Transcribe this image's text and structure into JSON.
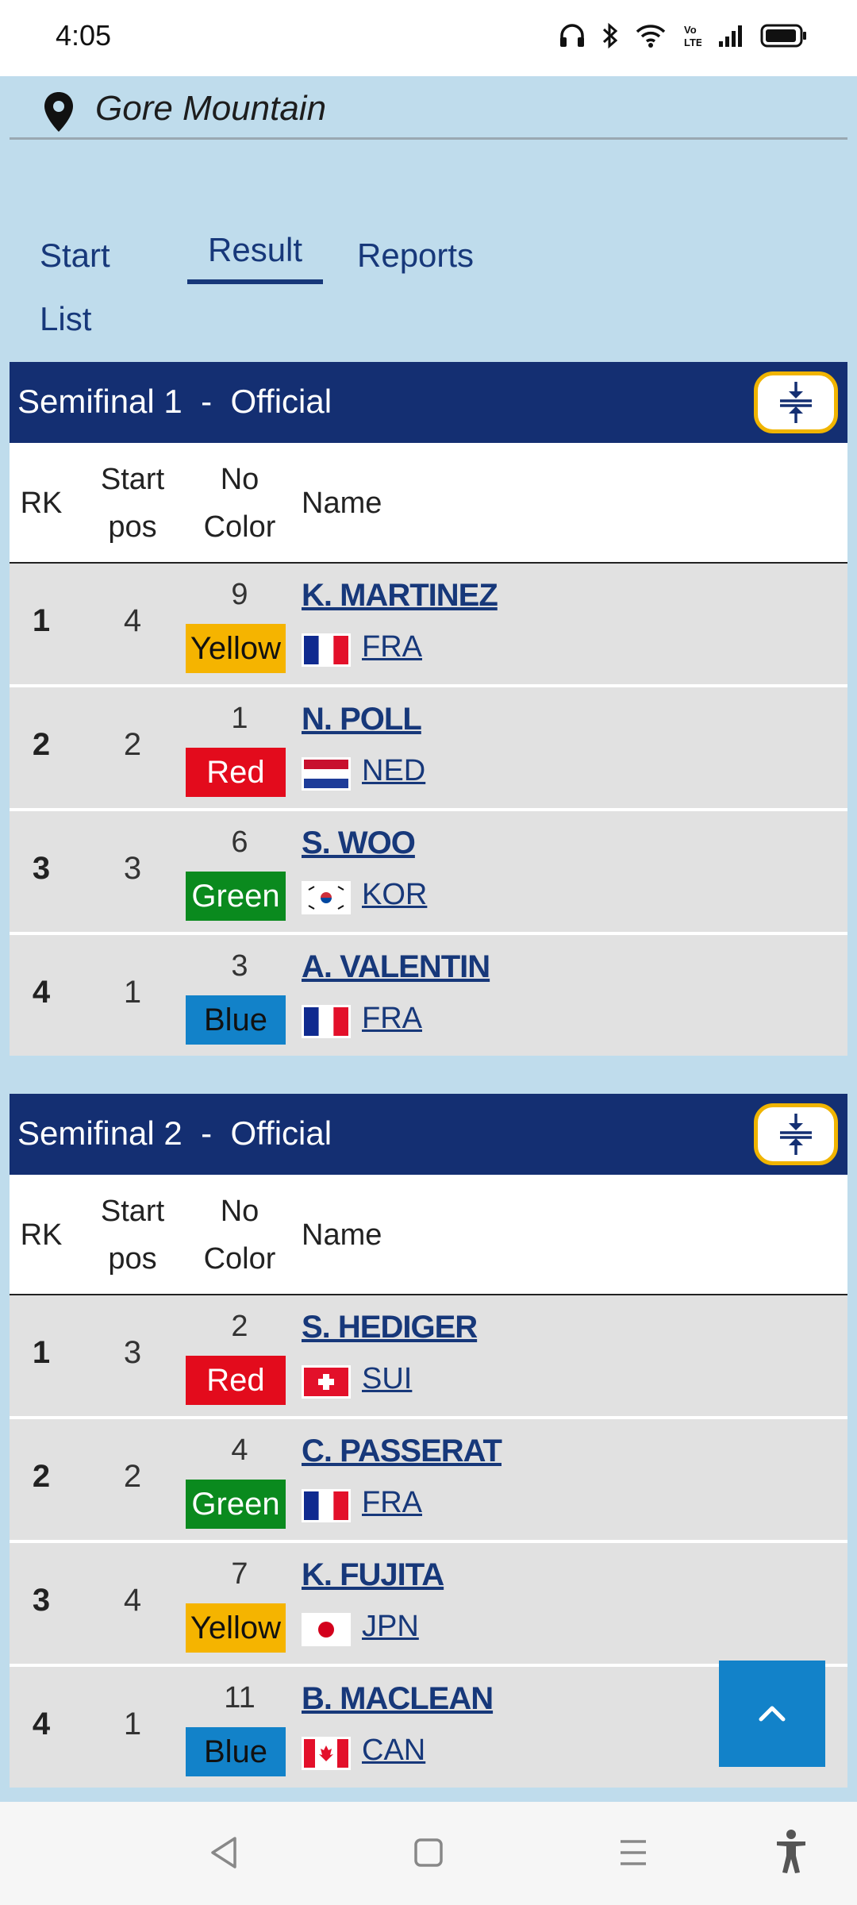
{
  "status_bar": {
    "time": "4:05",
    "icons": [
      "headphones-icon",
      "bluetooth-icon",
      "wifi-icon",
      "volte-icon",
      "signal-icon",
      "battery-icon"
    ],
    "volte_label": "Vo LTE"
  },
  "location": {
    "icon": "map-pin-icon",
    "name": "Gore Mountain"
  },
  "tabs": [
    {
      "label": "Start List",
      "active": false
    },
    {
      "label": "Result",
      "active": true
    },
    {
      "label": "Reports",
      "active": false
    }
  ],
  "columns": {
    "rk": "RK",
    "start_pos": "Start pos",
    "no": "No",
    "color": "Color",
    "name": "Name"
  },
  "colors": {
    "Yellow": {
      "bg": "#f5b400",
      "fg": "#111111"
    },
    "Red": {
      "bg": "#e30b1c",
      "fg": "#ffffff"
    },
    "Green": {
      "bg": "#0a8a1e",
      "fg": "#ffffff"
    },
    "Blue": {
      "bg": "#1282c9",
      "fg": "#111111"
    },
    "header_bg": "#142f72",
    "accent": "#17387a"
  },
  "heats": [
    {
      "title": "Semifinal 1",
      "separator": "-",
      "status": "Official",
      "rows": [
        {
          "rk": "1",
          "start_pos": "4",
          "bib": "9",
          "color": "Yellow",
          "name": "K. MARTINEZ",
          "nation": "FRA"
        },
        {
          "rk": "2",
          "start_pos": "2",
          "bib": "1",
          "color": "Red",
          "name": "N. POLL",
          "nation": "NED"
        },
        {
          "rk": "3",
          "start_pos": "3",
          "bib": "6",
          "color": "Green",
          "name": "S. WOO",
          "nation": "KOR"
        },
        {
          "rk": "4",
          "start_pos": "1",
          "bib": "3",
          "color": "Blue",
          "name": "A. VALENTIN",
          "nation": "FRA"
        }
      ]
    },
    {
      "title": "Semifinal 2",
      "separator": "-",
      "status": "Official",
      "rows": [
        {
          "rk": "1",
          "start_pos": "3",
          "bib": "2",
          "color": "Red",
          "name": "S. HEDIGER",
          "nation": "SUI"
        },
        {
          "rk": "2",
          "start_pos": "2",
          "bib": "4",
          "color": "Green",
          "name": "C. PASSERAT",
          "nation": "FRA"
        },
        {
          "rk": "3",
          "start_pos": "4",
          "bib": "7",
          "color": "Yellow",
          "name": "K. FUJITA",
          "nation": "JPN"
        },
        {
          "rk": "4",
          "start_pos": "1",
          "bib": "11",
          "color": "Blue",
          "name": "B. MACLEAN",
          "nation": "CAN"
        }
      ]
    }
  ],
  "scroll_top": {
    "icon": "chevron-up-icon"
  },
  "nav_bar": {
    "icons": [
      "back-icon",
      "home-icon",
      "recents-icon",
      "accessibility-icon"
    ]
  }
}
